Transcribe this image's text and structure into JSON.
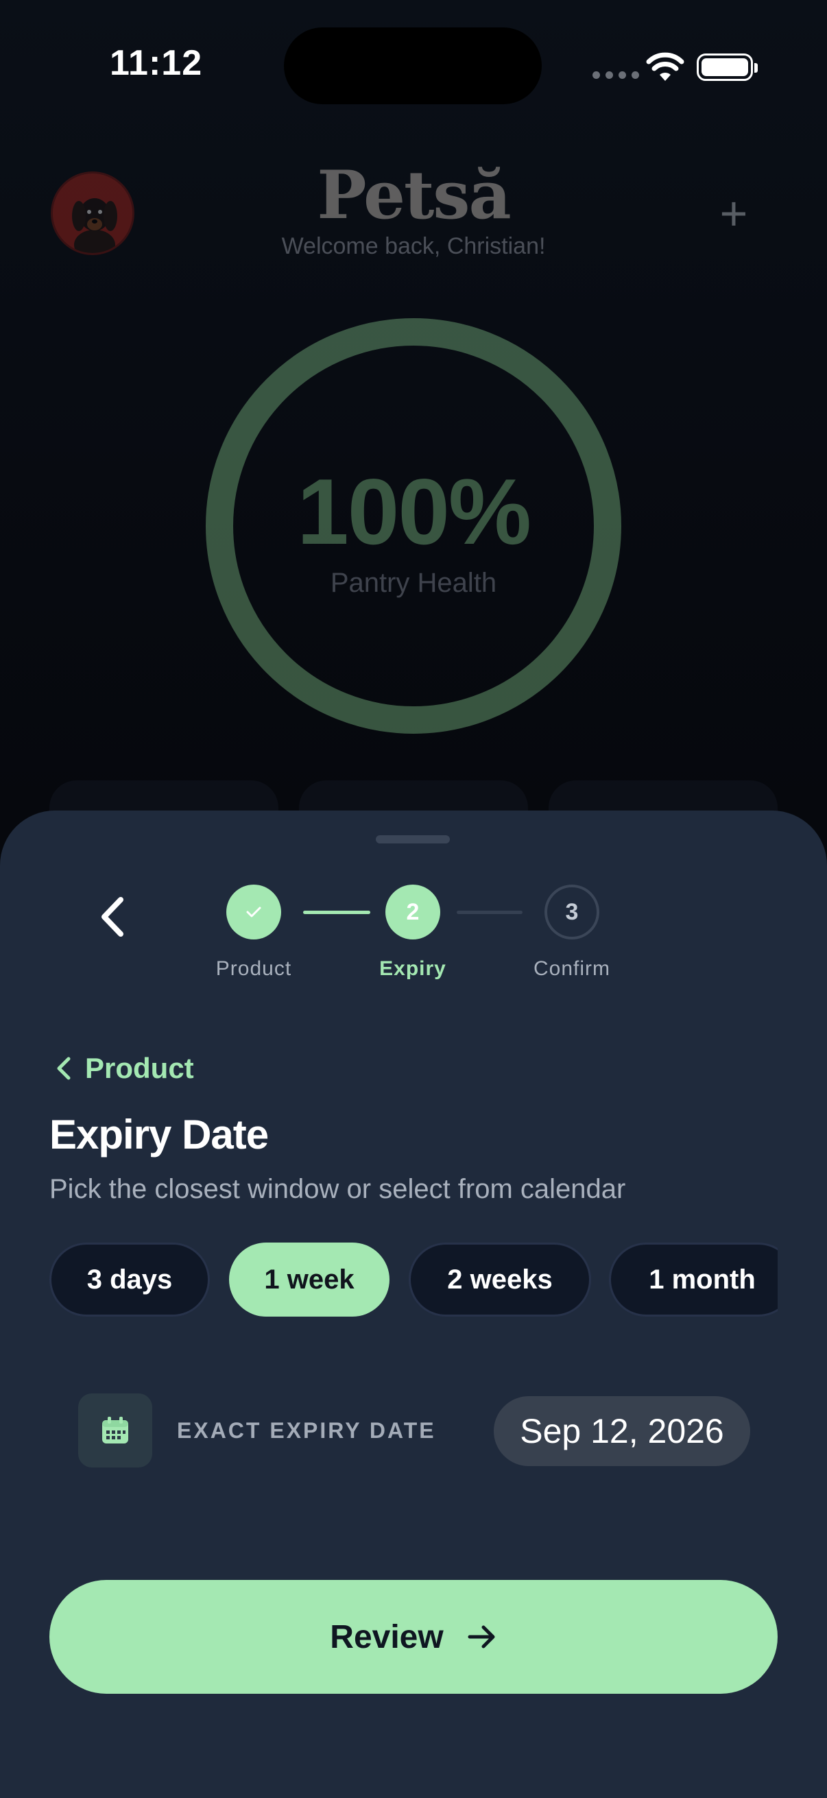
{
  "status_bar": {
    "time": "11:12"
  },
  "header": {
    "brand": "Petsă",
    "welcome": "Welcome back, Christian!"
  },
  "health": {
    "value": "100%",
    "label": "Pantry Health",
    "percent": 100
  },
  "stepper": {
    "steps": [
      {
        "number": "1",
        "label": "Product",
        "state": "done"
      },
      {
        "number": "2",
        "label": "Expiry",
        "state": "active"
      },
      {
        "number": "3",
        "label": "Confirm",
        "state": "todo"
      }
    ]
  },
  "sheet": {
    "back_crumb": "Product",
    "title": "Expiry Date",
    "subtitle": "Pick the closest window or select from calendar",
    "chips": [
      {
        "label": "3 days",
        "selected": false
      },
      {
        "label": "1 week",
        "selected": true
      },
      {
        "label": "2 weeks",
        "selected": false
      },
      {
        "label": "1 month",
        "selected": false
      }
    ],
    "exact_date_label": "EXACT EXPIRY DATE",
    "exact_date_value": "Sep 12, 2026",
    "review_label": "Review"
  },
  "colors": {
    "accent": "#a4e8b2",
    "sheet_bg": "#1f2a3c",
    "ring": "#7fbf86"
  }
}
